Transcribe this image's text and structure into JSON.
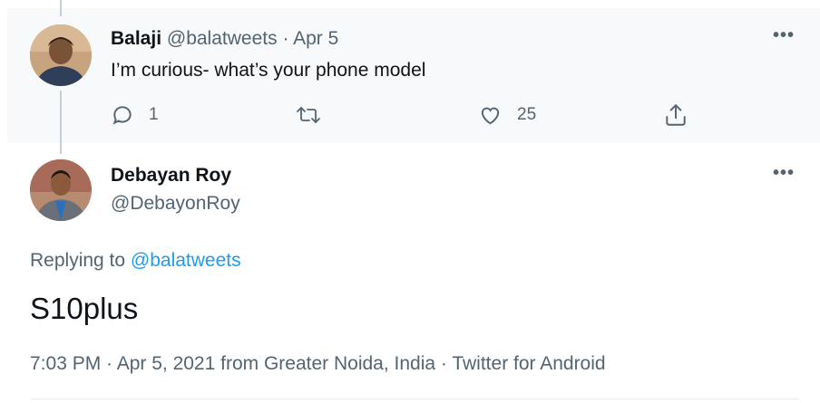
{
  "parent_tweet": {
    "name": "Balaji",
    "handle": "@balatweets",
    "separator": "·",
    "date": "Apr 5",
    "text": "I’m curious- what’s your phone model",
    "more": "•••",
    "actions": {
      "reply_count": "1",
      "like_count": "25"
    },
    "icons": [
      "reply-icon",
      "retweet-icon",
      "heart-icon",
      "share-icon"
    ]
  },
  "focused_tweet": {
    "name": "Debayan Roy",
    "handle": "@DebayonRoy",
    "more": "•••",
    "replying_prefix": "Replying to",
    "replying_to": "@balatweets",
    "text": "S10plus",
    "meta": "7:03 PM · Apr 5, 2021 from Greater Noida, India · Twitter for Android"
  },
  "colors": {
    "link": "#1d9bf0",
    "muted": "#536471",
    "parent_bg": "#f7f9fa"
  }
}
